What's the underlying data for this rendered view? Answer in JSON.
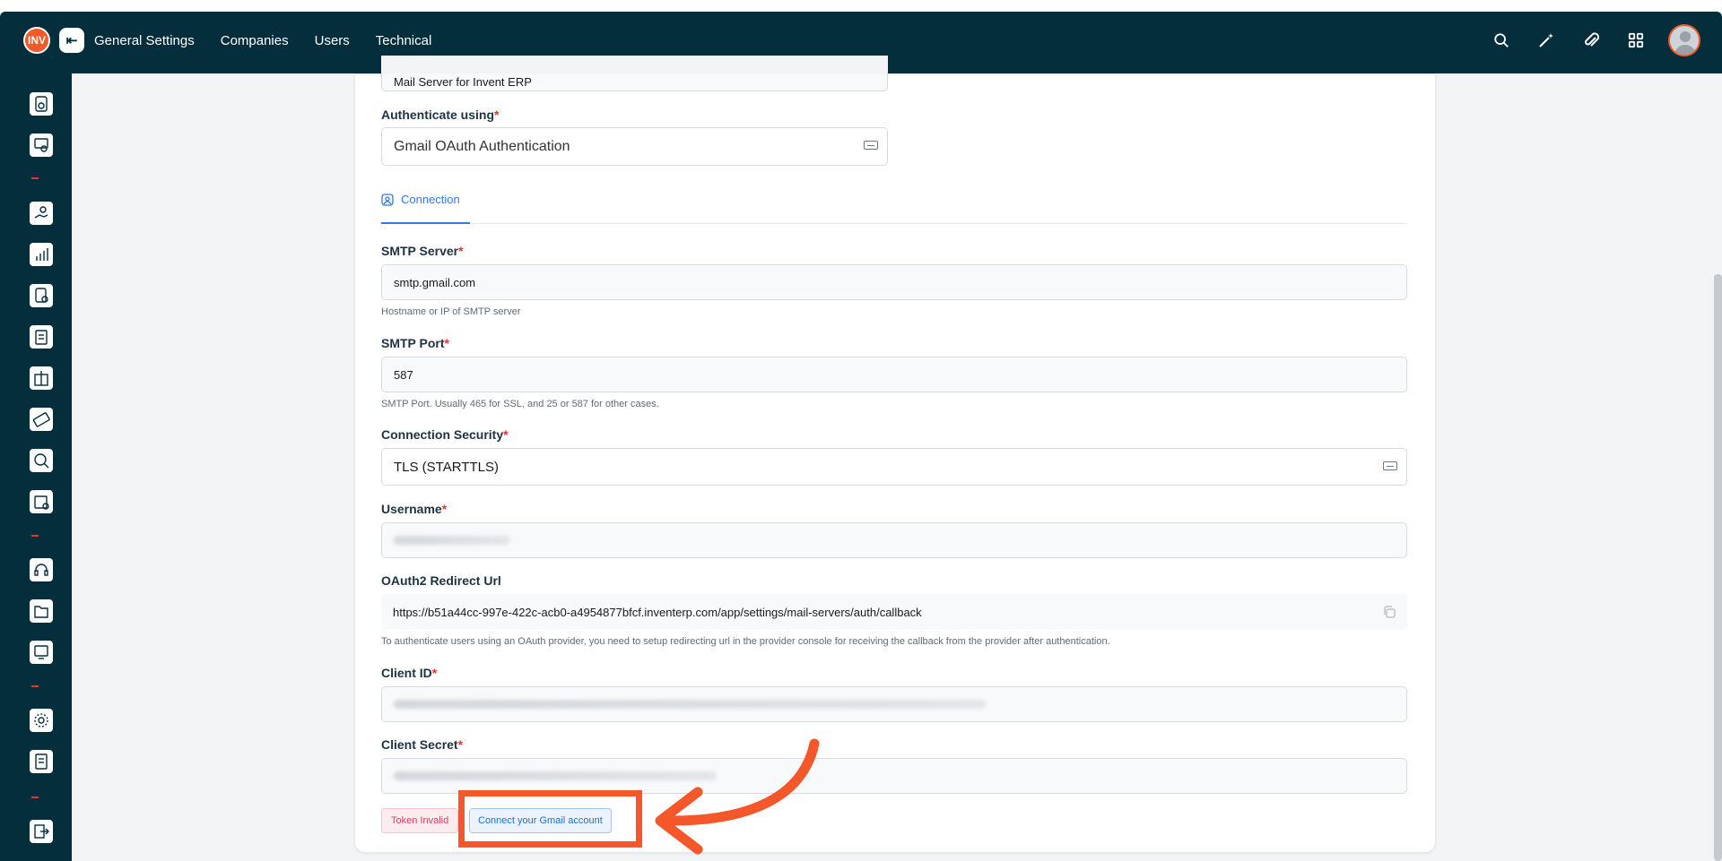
{
  "topbar": {
    "logo_text": "INV",
    "nav": [
      "General Settings",
      "Companies",
      "Users",
      "Technical"
    ],
    "icons": [
      "search-icon",
      "magic-wand-icon",
      "attachment-icon",
      "apps-grid-icon"
    ]
  },
  "sidebar": {
    "groups": [
      [
        "dashboard-icon",
        "pos-icon"
      ],
      [
        "sales-icon",
        "reports-icon",
        "documents-icon",
        "inventory-icon",
        "packages-icon",
        "payments-icon",
        "search-user-icon",
        "calendar-icon"
      ],
      [
        "support-icon",
        "files-icon",
        "monitor-icon"
      ],
      [
        "settings-icon",
        "checklist-icon"
      ],
      [
        "logout-icon"
      ]
    ]
  },
  "form": {
    "name_value": "Mail Server for Invent ERP",
    "auth_label": "Authenticate using",
    "auth_value": "Gmail OAuth Authentication",
    "tab_label": "Connection",
    "smtp_server_label": "SMTP Server",
    "smtp_server_value": "smtp.gmail.com",
    "smtp_server_help": "Hostname or IP of SMTP server",
    "smtp_port_label": "SMTP Port",
    "smtp_port_value": "587",
    "smtp_port_help": "SMTP Port. Usually 465 for SSL, and 25 or 587 for other cases.",
    "security_label": "Connection Security",
    "security_value": "TLS (STARTTLS)",
    "username_label": "Username",
    "redirect_label": "OAuth2 Redirect Url",
    "redirect_value": "https://b51a44cc-997e-422c-acb0-a4954877bfcf.inventerp.com/app/settings/mail-servers/auth/callback",
    "redirect_help": "To authenticate users using an OAuth provider, you need to setup redirecting url in the provider console for receiving the callback from the provider after authentication.",
    "client_id_label": "Client ID",
    "client_secret_label": "Client Secret",
    "required_mark": "*",
    "token_status": "Token Invalid",
    "connect_button": "Connect your Gmail account"
  },
  "colors": {
    "brand_dark": "#052e3d",
    "accent": "#2f7be5",
    "highlight": "#f3572a",
    "error": "#e13b5b"
  }
}
